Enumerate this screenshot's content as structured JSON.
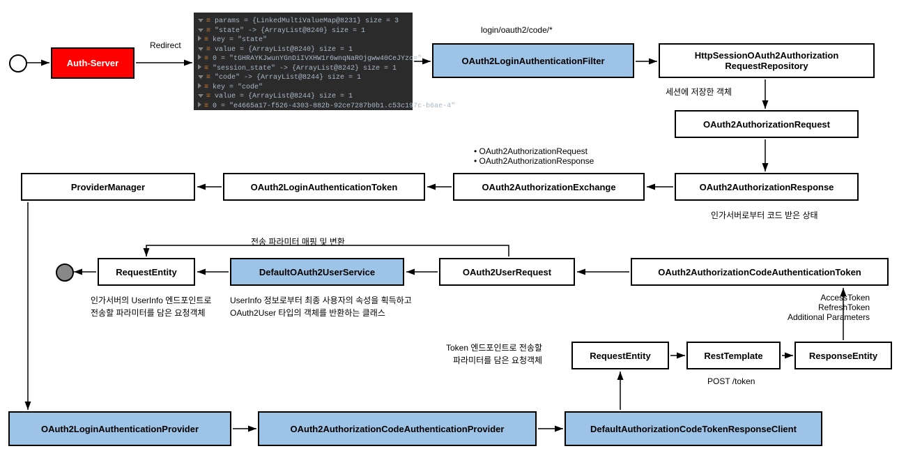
{
  "nodes": {
    "authServer": "Auth-Server",
    "redirect": "Redirect",
    "filterPath": "login/oauth2/code/*",
    "filter": "OAuth2LoginAuthenticationFilter",
    "sessionRepo": "HttpSessionOAuth2Authorization\nRequestRepository",
    "sessionNote": "세션에 저장한 객체",
    "authRequest": "OAuth2AuthorizationRequest",
    "authResponse": "OAuth2AuthorizationResponse",
    "authResponseNote": "인가서버로부터 코드 받은 상태",
    "exchange": "OAuth2AuthorizationExchange",
    "exchangeBullets": [
      "OAuth2AuthorizationRequest",
      "OAuth2AuthorizationResponse"
    ],
    "loginToken": "OAuth2LoginAuthenticationToken",
    "providerManager": "ProviderManager",
    "codeAuthToken": "OAuth2AuthorizationCodeAuthenticationToken",
    "tokenNotes": "AccessToken\nRefreshToken\nAdditional Parameters",
    "userRequest": "OAuth2UserRequest",
    "userRequestNote": "전송 파라미터 매핑 및 변환",
    "userService": "DefaultOAuth2UserService",
    "userServiceNote": "UserInfo 정보로부터 최종 사용자의 속성을 획득하고\nOAuth2User 타입의 객체를 반환하는 클래스",
    "requestEntity1": "RequestEntity",
    "requestEntity1Note": "인가서버의 UserInfo 엔드포인트로\n전송할 파라미터를 담은 요청객체",
    "requestEntity2": "RequestEntity",
    "requestEntity2Note": "Token 엔드포인트로 전송할\n파라미터를 담은 요청객체",
    "restTemplate": "RestTemplate",
    "postToken": "POST /token",
    "responseEntity": "ResponseEntity",
    "loginProvider": "OAuth2LoginAuthenticationProvider",
    "codeProvider": "OAuth2AuthorizationCodeAuthenticationProvider",
    "tokenClient": "DefaultAuthorizationCodeTokenResponseClient"
  },
  "debug": {
    "paramsHeader": "params = {LinkedMultiValueMap@8231}  size = 3",
    "rows": [
      {
        "indent": 1,
        "open": true,
        "text": "\"state\" -> {ArrayList@8240}  size = 1"
      },
      {
        "indent": 2,
        "open": false,
        "text": "key = \"state\""
      },
      {
        "indent": 2,
        "open": true,
        "text": "value = {ArrayList@8240}  size = 1"
      },
      {
        "indent": 3,
        "open": false,
        "text": "0 = \"tGHRAYKJwunYGnDiIVXHW1r6wnqNaROjgww40CeJYzc=\""
      },
      {
        "indent": 1,
        "open": false,
        "text": "\"session_state\" -> {ArrayList@8242}  size = 1"
      },
      {
        "indent": 1,
        "open": true,
        "text": "\"code\" -> {ArrayList@8244}  size = 1"
      },
      {
        "indent": 2,
        "open": false,
        "text": "key = \"code\""
      },
      {
        "indent": 2,
        "open": true,
        "text": "value = {ArrayList@8244}  size = 1"
      },
      {
        "indent": 3,
        "open": false,
        "text": "0 = \"e4665a17-f526-4303-882b-92ce7287b0b1.c53c197c-b6ae-4\""
      }
    ]
  }
}
